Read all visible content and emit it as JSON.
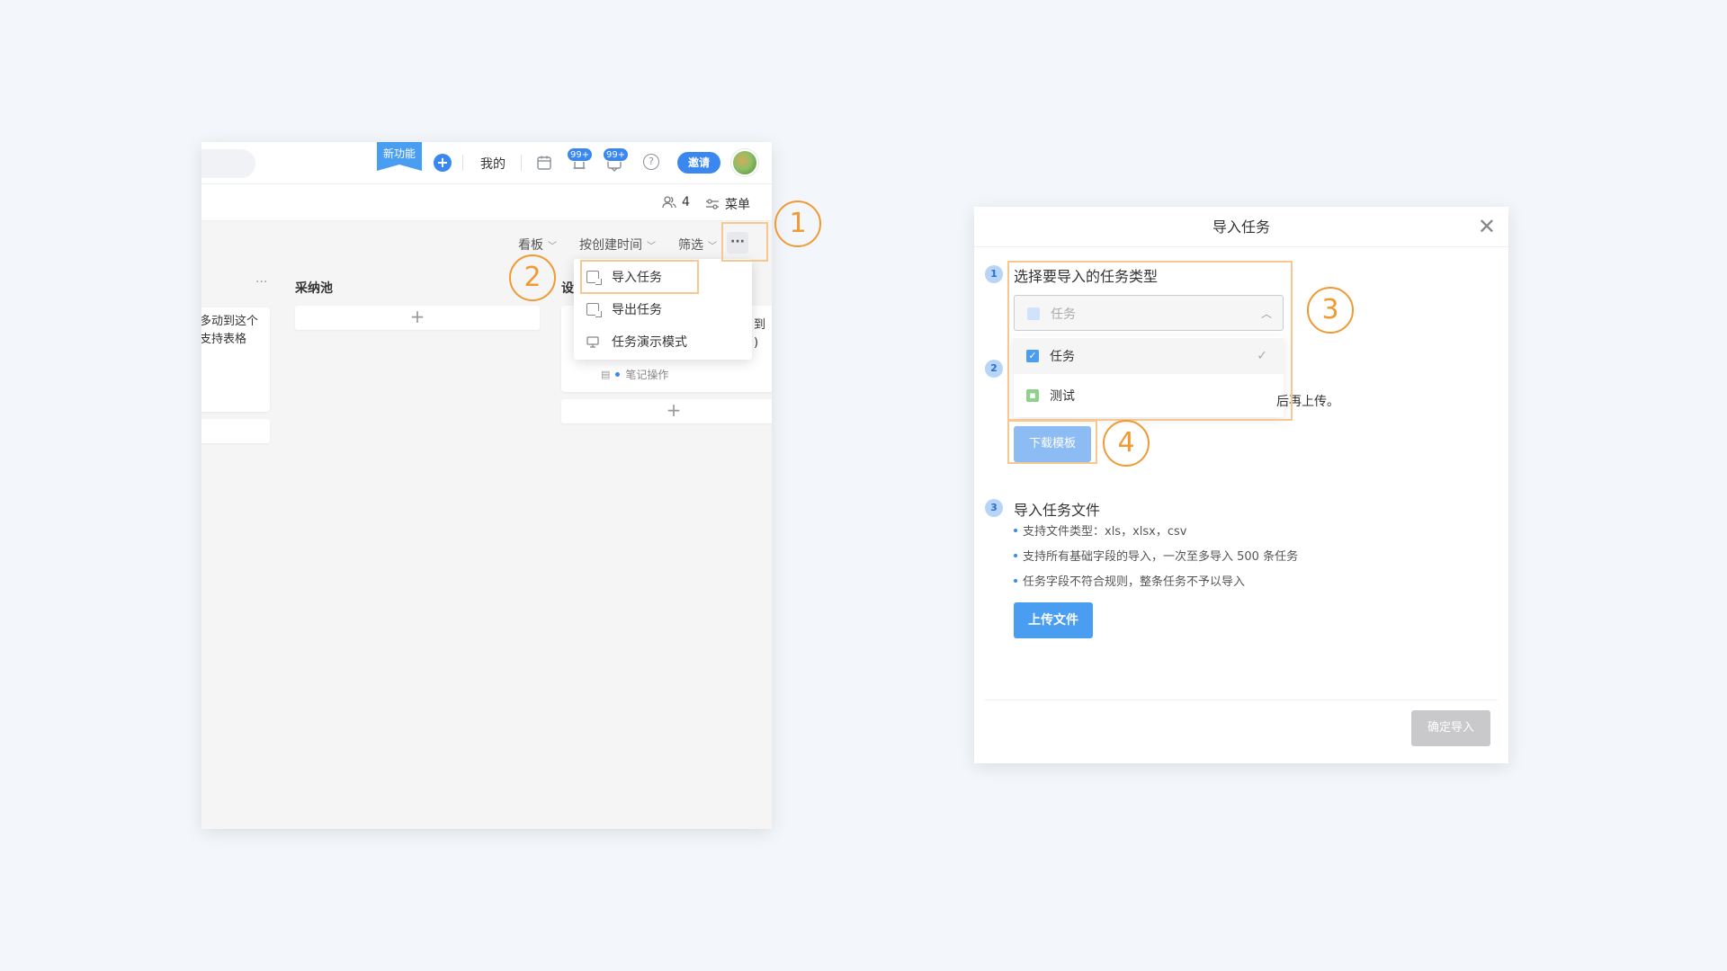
{
  "app": {
    "topbar": {
      "new_feature": "新功能",
      "add_icon": "+",
      "mine": "我的",
      "badge_notifications": "99+",
      "badge_messages": "99+",
      "help_icon": "?",
      "invite": "邀请"
    },
    "subbar": {
      "member_count": "4",
      "menu": "菜单"
    },
    "toolbar": {
      "view": "看板",
      "sort": "按创建时间",
      "filter": "筛选",
      "more": "···"
    },
    "columns": {
      "left_partial_line1": "多动到这个",
      "left_partial_line2": "支持表格",
      "col2_title": "采纳池",
      "col3_title_partial": "设",
      "col3_partial_line1": "到",
      "col3_partial_line2": ")",
      "col3_tag": "笔记操作",
      "add": "+"
    },
    "dropdown": {
      "items": [
        {
          "label": "导入任务",
          "icon": "import-icon"
        },
        {
          "label": "导出任务",
          "icon": "export-icon"
        },
        {
          "label": "任务演示模式",
          "icon": "presentation-icon"
        }
      ]
    }
  },
  "annotations": [
    "1",
    "2",
    "3",
    "4"
  ],
  "dialog": {
    "title": "导入任务",
    "close": "✕",
    "step1": {
      "num": "1",
      "title": "选择要导入的任务类型"
    },
    "select": {
      "value": "任务",
      "arrow": "︿"
    },
    "options": [
      {
        "label": "任务",
        "color": "#4a9ef2",
        "selected": true
      },
      {
        "label": "测试",
        "color": "#8fd08a",
        "selected": false
      }
    ],
    "step2": {
      "num": "2",
      "partial_text": "后再上传。"
    },
    "download_template": "下载模板",
    "step3": {
      "num": "3",
      "title": "导入任务文件"
    },
    "bullets": [
      "支持文件类型：xls，xlsx，csv",
      "支持所有基础字段的导入，一次至多导入 500 条任务",
      "任务字段不符合规则，整条任务不予以导入"
    ],
    "upload": "上传文件",
    "confirm": "确定导入"
  },
  "colors": {
    "accent": "#3b87f0",
    "annotation": "#ef9a32",
    "highlight": "#f6c78e"
  }
}
